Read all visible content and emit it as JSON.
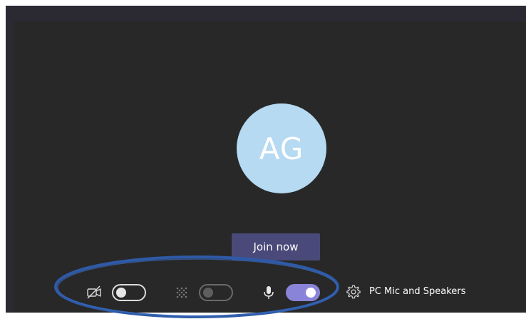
{
  "avatar": {
    "initials": "AG",
    "color": "#b5daf2"
  },
  "join_button": {
    "label": "Join now",
    "color": "#4a4a7a"
  },
  "controls": {
    "camera": {
      "icon": "camera-off-icon",
      "state": "off"
    },
    "background_blur": {
      "icon": "blur-background-icon",
      "state": "disabled"
    },
    "microphone": {
      "icon": "microphone-icon",
      "state": "on",
      "accent_color": "#8a84d8"
    },
    "device_settings": {
      "icon": "gear-icon",
      "label": "PC Mic and Speakers"
    }
  },
  "annotation": {
    "shape": "ellipse",
    "color": "#2e5aa8"
  }
}
